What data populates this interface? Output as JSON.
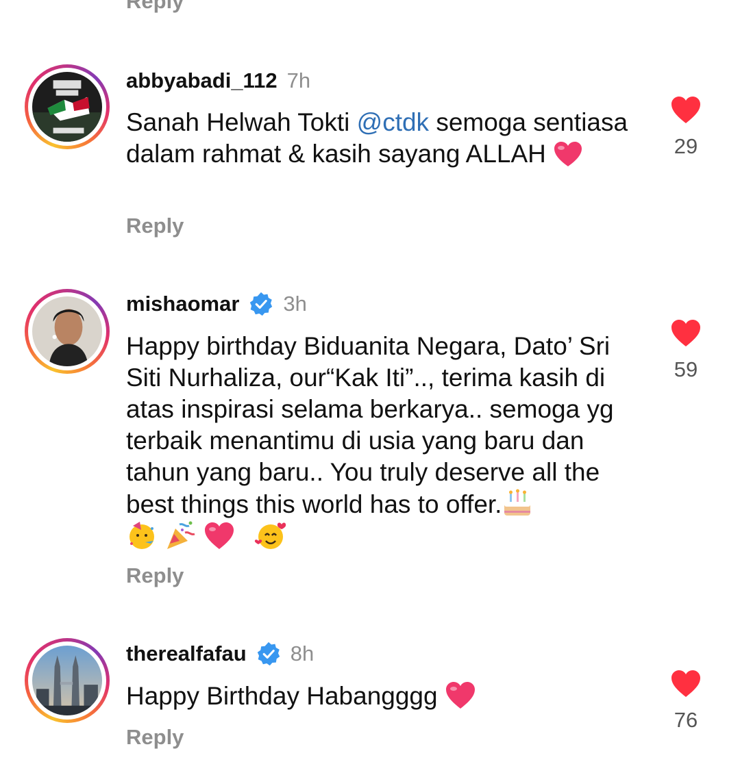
{
  "previous_reply_label": "Reply",
  "comments": [
    {
      "username": "abbyabadi_112",
      "time": "7h",
      "verified": false,
      "text_before_mention": "Sanah Helwah Tokti ",
      "mention": "@ctdk",
      "text_after_mention": " semoga sentiasa dalam rahmat & kasih sayang ALLAH",
      "avatar_text_top": "I STAND WITH",
      "avatar_text_bottom": "PALESTINE",
      "reply_label": "Reply",
      "likes": "29"
    },
    {
      "username": "mishaomar",
      "time": "3h",
      "verified": true,
      "text": "Happy birthday Biduanita Negara, Dato’ Sri Siti Nurhaliza, our“Kak Iti”.., terima kasih di atas inspirasi selama berkarya.. semoga yg terbaik menantimu di usia yang baru dan tahun yang baru.. You truly deserve all the best things this world has to offer.",
      "reply_label": "Reply",
      "likes": "59"
    },
    {
      "username": "therealfafau",
      "time": "8h",
      "verified": true,
      "text": "Happy Birthday Habangggg",
      "reply_label": "Reply",
      "likes": "76"
    }
  ],
  "icons": {
    "like": "heart-filled-icon",
    "verified": "verified-badge-icon"
  },
  "colors": {
    "like_red": "#ff3040",
    "verified_blue": "#3897f0",
    "mention_blue": "#2f6fb5",
    "muted_gray": "#8e8e8e"
  }
}
